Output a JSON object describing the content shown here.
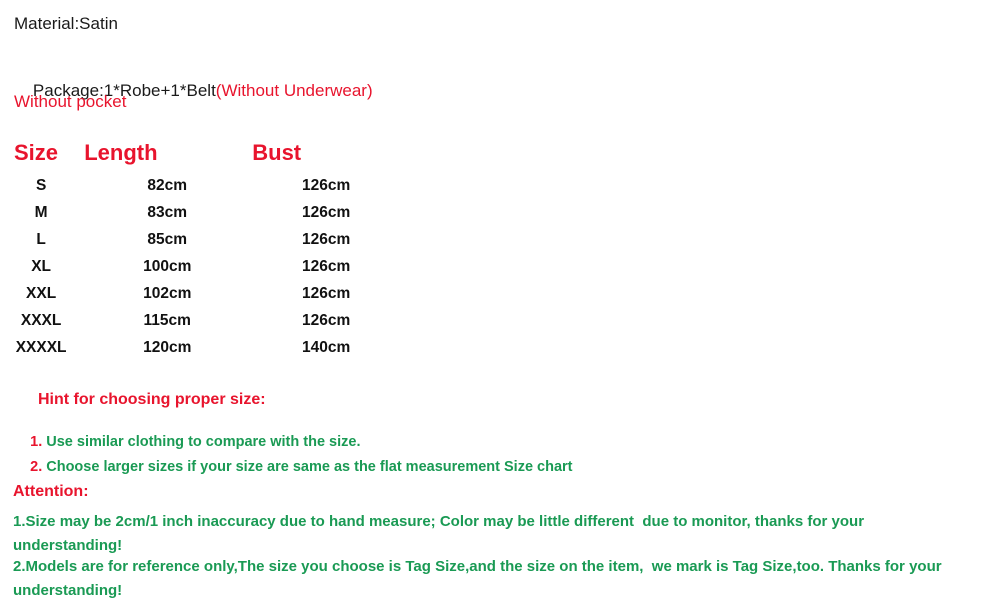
{
  "intro": {
    "material": "Material:Satin",
    "package_black": "Package:1*Robe+1*Belt",
    "package_red": "(Without Underwear)",
    "pocket": "Without pocket"
  },
  "size_chart": {
    "headers": [
      "Size",
      "Length",
      "Bust"
    ],
    "rows": [
      {
        "size": "S",
        "length": "82cm",
        "bust": "126cm"
      },
      {
        "size": "M",
        "length": "83cm",
        "bust": "126cm"
      },
      {
        "size": "L",
        "length": "85cm",
        "bust": "126cm"
      },
      {
        "size": "XL",
        "length": "100cm",
        "bust": "126cm"
      },
      {
        "size": "XXL",
        "length": "102cm",
        "bust": "126cm"
      },
      {
        "size": "XXXL",
        "length": "115cm",
        "bust": "126cm"
      },
      {
        "size": "XXXXL",
        "length": "120cm",
        "bust": "140cm"
      }
    ]
  },
  "hint": {
    "title": "Hint for choosing proper size:",
    "item1_number": "1. ",
    "item1_text": "Use similar clothing to compare with the size.",
    "item2_number": "2. ",
    "item2_text": "Choose larger sizes if your size are same as the flat measurement Size chart"
  },
  "attention": {
    "title": "Attention:",
    "item1": "1.Size may be 2cm/1 inch inaccuracy due to hand measure; Color may be little different  due to monitor, thanks for your understanding!",
    "item2": "2.Models are for reference only,The size you choose is Tag Size,and the size on the item,  we mark is Tag Size,too. Thanks for your understanding!"
  },
  "colors": {
    "red": "#e8142d",
    "green": "#1a9a54",
    "black": "#1a1a1a",
    "background": "#ffffff"
  }
}
